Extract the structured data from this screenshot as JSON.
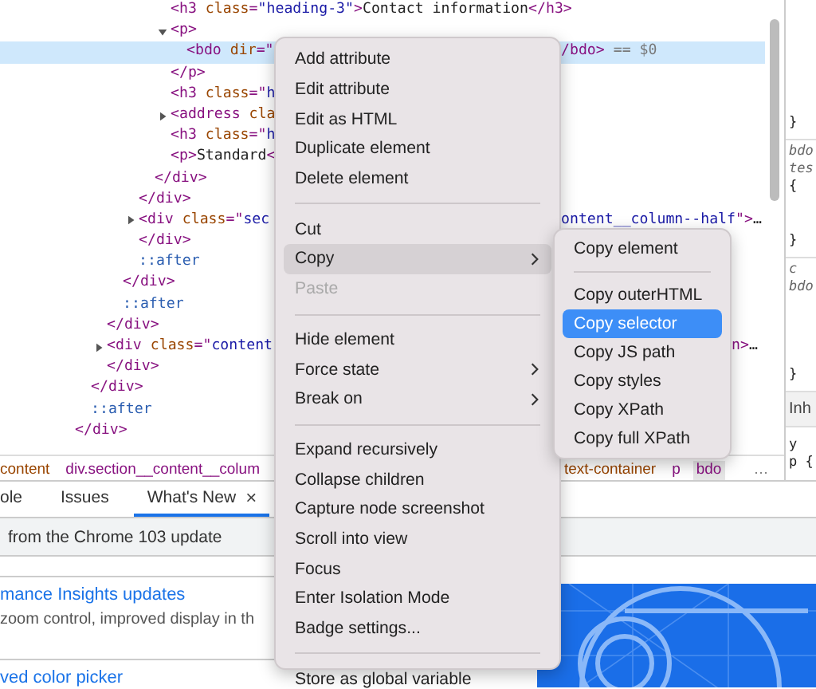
{
  "dom_tree": [
    {
      "children": [
        {
          "children": [
            {
              "children": [
                {
                  "children": [
                    {
                      "children": [
                        {
                          "children": [
                            {
                              "children": [
                                {
                                  "selected": false,
                                  "tokens": [
                                    {
                                      "kind": "tag",
                                      "text": "<h3 "
                                    },
                                    {
                                      "kind": "attr",
                                      "text": "class"
                                    },
                                    {
                                      "kind": "tag",
                                      "text": "="
                                    },
                                    {
                                      "kind": "value",
                                      "text": "\"heading-3\""
                                    },
                                    {
                                      "kind": "tag",
                                      "text": ">"
                                    },
                                    {
                                      "kind": "text",
                                      "text": "Contact information"
                                    },
                                    {
                                      "kind": "tag",
                                      "text": "</h3>"
                                    }
                                  ]
                                },
                                {
                                  "selected": false,
                                  "expanded": true,
                                  "tokens": [
                                    {
                                      "kind": "tag",
                                      "text": "<p>"
                                    }
                                  ],
                                  "children": [
                                    {
                                      "selected": true,
                                      "tokens": [
                                        {
                                          "kind": "tag",
                                          "text": "<bdo "
                                        },
                                        {
                                          "kind": "attr",
                                          "text": "dir"
                                        },
                                        {
                                          "kind": "tag",
                                          "text": "=\""
                                        }
                                      ],
                                      "after_menu": [
                                        {
                                          "kind": "tag",
                                          "text": "/bdo>"
                                        },
                                        {
                                          "kind": "comment",
                                          "text": " == $0"
                                        }
                                      ]
                                    }
                                  ]
                                },
                                {
                                  "selected": false,
                                  "tokens": [
                                    {
                                      "kind": "tag",
                                      "text": "</p>"
                                    }
                                  ]
                                },
                                {
                                  "selected": false,
                                  "tokens": [
                                    {
                                      "kind": "tag",
                                      "text": "<h3 "
                                    },
                                    {
                                      "kind": "attr",
                                      "text": "class"
                                    },
                                    {
                                      "kind": "tag",
                                      "text": "=\""
                                    },
                                    {
                                      "kind": "value",
                                      "text": "h"
                                    }
                                  ]
                                },
                                {
                                  "selected": false,
                                  "expanded": false,
                                  "tokens": [
                                    {
                                      "kind": "tag",
                                      "text": "<address "
                                    },
                                    {
                                      "kind": "attr",
                                      "text": "cla"
                                    }
                                  ]
                                },
                                {
                                  "selected": false,
                                  "tokens": [
                                    {
                                      "kind": "tag",
                                      "text": "<h3 "
                                    },
                                    {
                                      "kind": "attr",
                                      "text": "class"
                                    },
                                    {
                                      "kind": "tag",
                                      "text": "=\""
                                    },
                                    {
                                      "kind": "value",
                                      "text": "h"
                                    }
                                  ]
                                },
                                {
                                  "selected": false,
                                  "tokens": [
                                    {
                                      "kind": "tag",
                                      "text": "<p>"
                                    },
                                    {
                                      "kind": "text",
                                      "text": "Standard"
                                    },
                                    {
                                      "kind": "tag",
                                      "text": "<"
                                    }
                                  ]
                                }
                              ]
                            },
                            {
                              "selected": false,
                              "tokens": [
                                {
                                  "kind": "tag",
                                  "text": "</div>"
                                }
                              ]
                            }
                          ]
                        },
                        {
                          "selected": false,
                          "tokens": [
                            {
                              "kind": "tag",
                              "text": "</div>"
                            }
                          ]
                        },
                        {
                          "selected": false,
                          "expanded": false,
                          "tokens": [
                            {
                              "kind": "tag",
                              "text": "<div "
                            },
                            {
                              "kind": "attr",
                              "text": "class"
                            },
                            {
                              "kind": "tag",
                              "text": "=\""
                            },
                            {
                              "kind": "value",
                              "text": "sec"
                            }
                          ],
                          "after_menu": [
                            {
                              "kind": "value",
                              "text": "ontent__column--half"
                            },
                            {
                              "kind": "tag",
                              "text": "\">"
                            },
                            {
                              "kind": "text",
                              "text": "…"
                            }
                          ]
                        },
                        {
                          "selected": false,
                          "tokens": [
                            {
                              "kind": "tag",
                              "text": "</div>"
                            }
                          ]
                        },
                        {
                          "selected": false,
                          "tokens": [
                            {
                              "kind": "pseudo",
                              "text": "::after"
                            }
                          ]
                        }
                      ]
                    },
                    {
                      "selected": false,
                      "tokens": [
                        {
                          "kind": "tag",
                          "text": "</div>"
                        }
                      ]
                    },
                    {
                      "selected": false,
                      "tokens": [
                        {
                          "kind": "pseudo",
                          "text": "::after"
                        }
                      ]
                    }
                  ]
                },
                {
                  "selected": false,
                  "tokens": [
                    {
                      "kind": "tag",
                      "text": "</div>"
                    }
                  ]
                },
                {
                  "selected": false,
                  "expanded": false,
                  "tokens": [
                    {
                      "kind": "tag",
                      "text": "<div "
                    },
                    {
                      "kind": "attr",
                      "text": "class"
                    },
                    {
                      "kind": "tag",
                      "text": "=\""
                    },
                    {
                      "kind": "value",
                      "text": "content"
                    }
                  ],
                  "after_submenu": [
                    {
                      "kind": "tag",
                      "text": "n>"
                    },
                    {
                      "kind": "text",
                      "text": "…"
                    }
                  ]
                },
                {
                  "selected": false,
                  "tokens": [
                    {
                      "kind": "tag",
                      "text": "</div>"
                    }
                  ]
                }
              ]
            },
            {
              "selected": false,
              "tokens": [
                {
                  "kind": "tag",
                  "text": "</div>"
                }
              ]
            },
            {
              "selected": false,
              "tokens": [
                {
                  "kind": "pseudo",
                  "text": "::after"
                }
              ]
            }
          ]
        },
        {
          "selected": false,
          "tokens": [
            {
              "kind": "tag",
              "text": "</div>"
            }
          ]
        }
      ]
    }
  ],
  "breadcrumb": {
    "before_menu": [
      {
        "kind": "class",
        "text": "content",
        "selected": false
      },
      {
        "kind": "tag",
        "text": "div.section__content__colum",
        "selected": false
      }
    ],
    "after_menu": [
      {
        "kind": "class",
        "text": "text-container",
        "selected": false
      },
      {
        "kind": "tag",
        "text": "p",
        "selected": false
      },
      {
        "kind": "tag",
        "text": "bdo",
        "selected": true
      }
    ],
    "more": "…"
  },
  "styles_pane": [
    {
      "kind": "rule",
      "lines": [
        {
          "kind": "code",
          "text": "}"
        }
      ]
    },
    {
      "kind": "rule",
      "lines": [
        {
          "kind": "source",
          "text": "bdo"
        },
        {
          "kind": "source",
          "text": "tes"
        },
        {
          "kind": "code",
          "text": "{"
        },
        {
          "kind": "code",
          "text": "}"
        }
      ]
    },
    {
      "kind": "rule",
      "lines": [
        {
          "kind": "source",
          "text": "c"
        },
        {
          "kind": "source",
          "text": "bdo"
        },
        {
          "kind": "code",
          "text": "}"
        }
      ]
    },
    {
      "kind": "header",
      "text": "Inh"
    },
    {
      "kind": "rule",
      "lines": [
        {
          "kind": "code",
          "text": "y"
        },
        {
          "kind": "code",
          "text": "p {"
        }
      ]
    }
  ],
  "drawer_tabs": [
    {
      "label": "ole",
      "selected": false
    },
    {
      "label": "Issues",
      "selected": false
    },
    {
      "label": "What's New",
      "selected": true,
      "close": "×"
    }
  ],
  "banner": "from the Chrome 103 update",
  "articles": [
    {
      "title": "mance Insights updates",
      "summary": "zoom control, improved display in th"
    },
    {
      "title": "ved color picker"
    }
  ],
  "context_menu": [
    {
      "kind": "item",
      "label": "Add attribute",
      "selected": false,
      "disabled": false,
      "submenu": false
    },
    {
      "kind": "item",
      "label": "Edit attribute",
      "selected": false,
      "disabled": false,
      "submenu": false
    },
    {
      "kind": "item",
      "label": "Edit as HTML",
      "selected": false,
      "disabled": false,
      "submenu": false
    },
    {
      "kind": "item",
      "label": "Duplicate element",
      "selected": false,
      "disabled": false,
      "submenu": false
    },
    {
      "kind": "item",
      "label": "Delete element",
      "selected": false,
      "disabled": false,
      "submenu": false
    },
    {
      "kind": "separator"
    },
    {
      "kind": "item",
      "label": "Cut",
      "selected": false,
      "disabled": false,
      "submenu": false
    },
    {
      "kind": "item",
      "label": "Copy",
      "selected": true,
      "disabled": false,
      "submenu": true
    },
    {
      "kind": "item",
      "label": "Paste",
      "selected": false,
      "disabled": true,
      "submenu": false
    },
    {
      "kind": "separator"
    },
    {
      "kind": "item",
      "label": "Hide element",
      "selected": false,
      "disabled": false,
      "submenu": false
    },
    {
      "kind": "item",
      "label": "Force state",
      "selected": false,
      "disabled": false,
      "submenu": true
    },
    {
      "kind": "item",
      "label": "Break on",
      "selected": false,
      "disabled": false,
      "submenu": true
    },
    {
      "kind": "separator"
    },
    {
      "kind": "item",
      "label": "Expand recursively",
      "selected": false,
      "disabled": false,
      "submenu": false
    },
    {
      "kind": "item",
      "label": "Collapse children",
      "selected": false,
      "disabled": false,
      "submenu": false
    },
    {
      "kind": "item",
      "label": "Capture node screenshot",
      "selected": false,
      "disabled": false,
      "submenu": false
    },
    {
      "kind": "item",
      "label": "Scroll into view",
      "selected": false,
      "disabled": false,
      "submenu": false
    },
    {
      "kind": "item",
      "label": "Focus",
      "selected": false,
      "disabled": false,
      "submenu": false
    },
    {
      "kind": "item",
      "label": "Enter Isolation Mode",
      "selected": false,
      "disabled": false,
      "submenu": false
    },
    {
      "kind": "item",
      "label": "Badge settings...",
      "selected": false,
      "disabled": false,
      "submenu": false
    },
    {
      "kind": "separator"
    },
    {
      "kind": "item",
      "label": "Store as global variable",
      "selected": false,
      "disabled": false,
      "submenu": false
    }
  ],
  "copy_submenu": [
    {
      "kind": "item",
      "label": "Copy element",
      "selected": false
    },
    {
      "kind": "separator"
    },
    {
      "kind": "item",
      "label": "Copy outerHTML",
      "selected": false
    },
    {
      "kind": "item",
      "label": "Copy selector",
      "selected": true
    },
    {
      "kind": "item",
      "label": "Copy JS path",
      "selected": false
    },
    {
      "kind": "item",
      "label": "Copy styles",
      "selected": false
    },
    {
      "kind": "item",
      "label": "Copy XPath",
      "selected": false
    },
    {
      "kind": "item",
      "label": "Copy full XPath",
      "selected": false
    }
  ]
}
